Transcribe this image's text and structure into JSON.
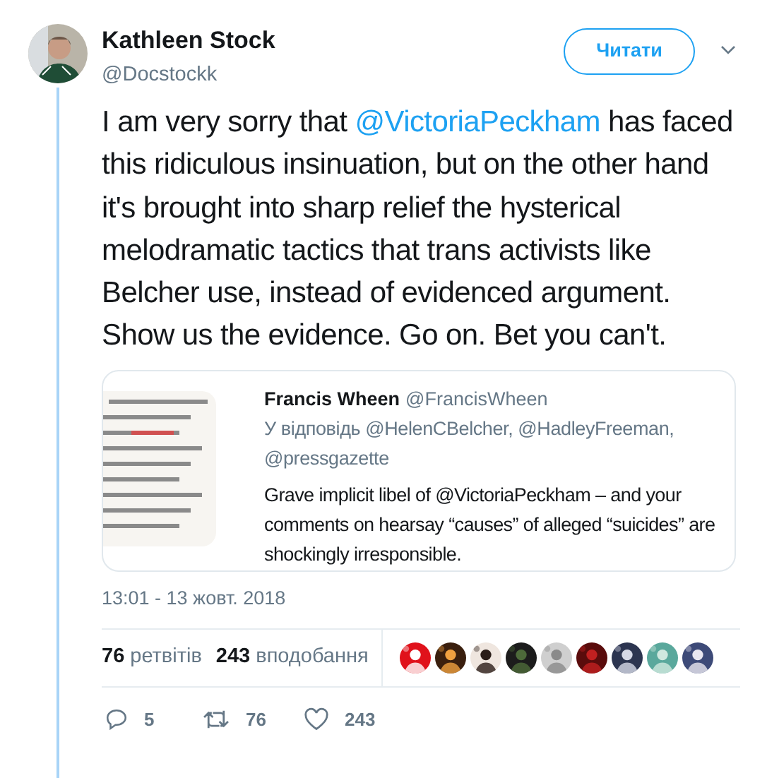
{
  "author": {
    "name": "Kathleen Stock",
    "handle": "@Docstockk"
  },
  "follow_button": "Читати",
  "tweet_text": [
    {
      "kind": "text",
      "text": "I am very sorry that "
    },
    {
      "kind": "mention",
      "text": "@VictoriaPeckham"
    },
    {
      "kind": "text",
      "text": " has faced this ridiculous insinuation, but on the other hand it's brought into sharp relief the hysterical melodramatic tactics that trans activists like Belcher use, instead of evidenced argument. Show us the evidence. Go on. Bet you can't."
    }
  ],
  "quoted_tweet": {
    "name": "Francis Wheen",
    "handle": "@FrancisWheen",
    "reply_to": "У відповідь @HelenCBelcher, @HadleyFreeman, @pressgazette",
    "text": "Grave implicit libel of @VictoriaPeckham – and your comments on hearsay “causes” of alleged “suicides” are shockingly irresponsible."
  },
  "timestamp": "13:01 - 13 жовт. 2018",
  "stats": [
    {
      "count": "76",
      "label": "ретвітів"
    },
    {
      "count": "243",
      "label": "вподобання"
    }
  ],
  "actions": [
    {
      "kind": "reply",
      "count": "5"
    },
    {
      "kind": "retweet",
      "count": "76"
    },
    {
      "kind": "like",
      "count": "243"
    }
  ]
}
